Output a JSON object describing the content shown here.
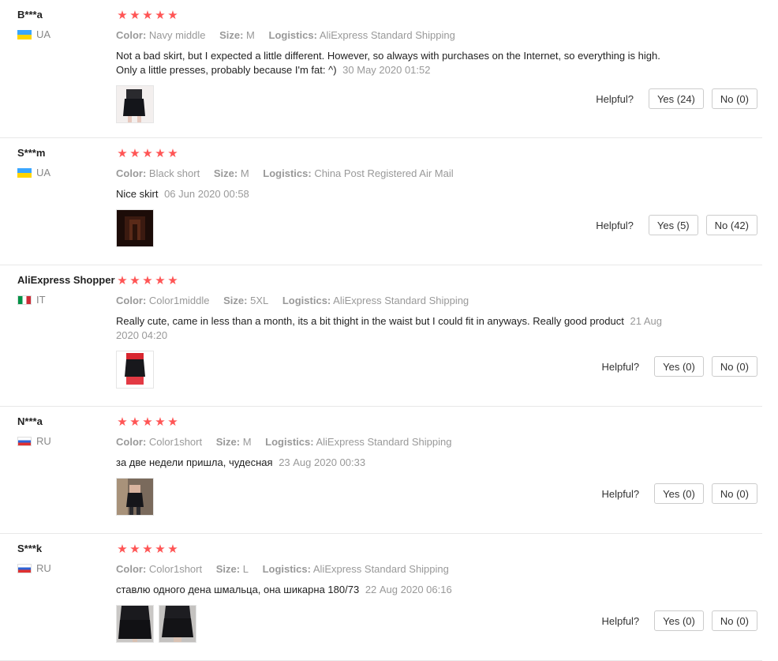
{
  "helpful_label": "Helpful?",
  "labels": {
    "color": "Color:",
    "size": "Size:",
    "logistics": "Logistics:"
  },
  "star_color": "#ff5555",
  "rating_stars": 5,
  "reviews": [
    {
      "name": "B***a",
      "country": "UA",
      "color": "Navy middle",
      "size": "M",
      "logistics": "AliExpress Standard Shipping",
      "text": "Not a bad skirt, but I expected a little different. However, so always with purchases on the Internet, so everything is high. Only a little presses, probably because I'm fat: ^)",
      "date": "30 May 2020 01:52",
      "yes": "Yes (24)",
      "no": "No (0)"
    },
    {
      "name": "S***m",
      "country": "UA",
      "color": "Black short",
      "size": "M",
      "logistics": "China Post Registered Air Mail",
      "text": "Nice skirt",
      "date": "06 Jun 2020 00:58",
      "yes": "Yes (5)",
      "no": "No (42)"
    },
    {
      "name": "AliExpress Shopper",
      "country": "IT",
      "color": "Color1middle",
      "size": "5XL",
      "logistics": "AliExpress Standard Shipping",
      "text": "Really cute, came in less than a month, its a bit thight in the waist but I could fit in anyways. Really good product",
      "date": "21 Aug 2020 04:20",
      "yes": "Yes (0)",
      "no": "No (0)"
    },
    {
      "name": "N***a",
      "country": "RU",
      "color": "Color1short",
      "size": "M",
      "logistics": "AliExpress Standard Shipping",
      "text": "за две недели пришла, чудесная",
      "date": "23 Aug 2020 00:33",
      "yes": "Yes (0)",
      "no": "No (0)"
    },
    {
      "name": "S***k",
      "country": "RU",
      "color": "Color1short",
      "size": "L",
      "logistics": "AliExpress Standard Shipping",
      "text": "ставлю одного дена шмальца, она шикарна 180/73",
      "date": "22 Aug 2020 06:16",
      "yes": "Yes (0)",
      "no": "No (0)"
    }
  ]
}
